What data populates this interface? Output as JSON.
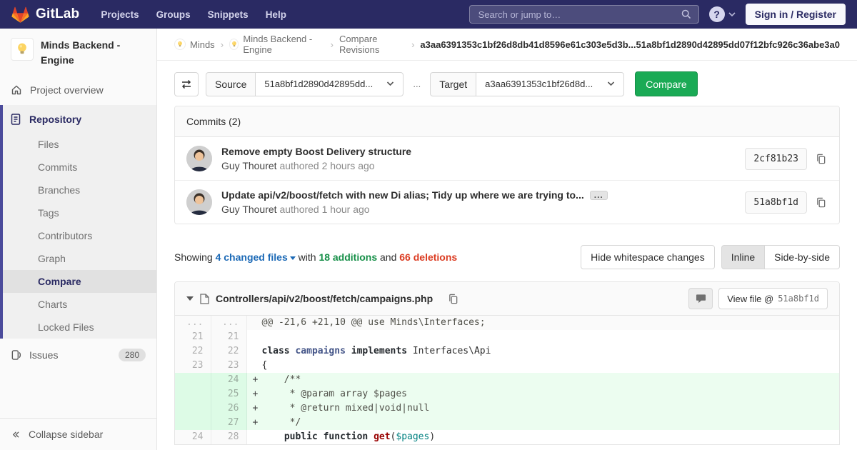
{
  "colors": {
    "navbar_bg": "#2a2a63",
    "accent_green": "#1aaa55",
    "link_blue": "#1b69b6",
    "additions_green": "#168f48",
    "deletions_red": "#db3b21",
    "sidebar_active_indigo": "#4b4b9b",
    "added_line_bg": "#ecfdf0",
    "added_gutter_bg": "#ddfbe6"
  },
  "navbar": {
    "logo_text": "GitLab",
    "items": [
      "Projects",
      "Groups",
      "Snippets",
      "Help"
    ],
    "search_placeholder": "Search or jump to…",
    "help_glyph": "?",
    "signin_label": "Sign in / Register"
  },
  "sidebar": {
    "project_name": "Minds Backend - Engine",
    "overview_label": "Project overview",
    "repository_label": "Repository",
    "repo_items": [
      "Files",
      "Commits",
      "Branches",
      "Tags",
      "Contributors",
      "Graph",
      "Compare",
      "Charts",
      "Locked Files"
    ],
    "active_item": "Compare",
    "issues_label": "Issues",
    "issues_count": "280",
    "collapse_label": "Collapse sidebar"
  },
  "breadcrumb": {
    "items": [
      {
        "label": "Minds",
        "avatar": true
      },
      {
        "label": "Minds Backend - Engine",
        "avatar": true
      },
      {
        "label": "Compare Revisions",
        "avatar": false
      }
    ],
    "current": "a3aa6391353c1bf26d8db41d8596e61c303e5d3b...51a8bf1d2890d42895dd07f12bfc926c36abe3a0"
  },
  "compare_form": {
    "source_label": "Source",
    "source_value": "51a8bf1d2890d42895dd...",
    "separator": "...",
    "target_label": "Target",
    "target_value": "a3aa6391353c1bf26d8d...",
    "compare_button": "Compare"
  },
  "commits": {
    "header": "Commits (2)",
    "items": [
      {
        "title": "Remove empty Boost Delivery structure",
        "author": "Guy Thouret",
        "meta": "authored 2 hours ago",
        "hash": "2cf81b23",
        "expandable": false
      },
      {
        "title": "Update api/v2/boost/fetch with new Di alias; Tidy up where we are trying to...",
        "author": "Guy Thouret",
        "meta": "authored 1 hour ago",
        "hash": "51a8bf1d",
        "expandable": true
      }
    ]
  },
  "diff_summary": {
    "showing": "Showing",
    "files_link": "4 changed files",
    "with_word": "with",
    "additions": "18 additions",
    "and_word": "and",
    "deletions": "66 deletions",
    "hide_whitespace": "Hide whitespace changes",
    "inline": "Inline",
    "side_by_side": "Side-by-side"
  },
  "file_diff": {
    "path": "Controllers/api/v2/boost/fetch/campaigns.php",
    "view_file_label": "View file @",
    "view_file_hash": "51a8bf1d",
    "lines": [
      {
        "type": "match",
        "old": "...",
        "new": "...",
        "sign": "",
        "segments": [
          {
            "t": "c",
            "s": "@@ -21,6 +21,10 @@ use Minds\\Interfaces;"
          }
        ]
      },
      {
        "type": "ctx",
        "old": "21",
        "new": "21",
        "sign": "",
        "segments": []
      },
      {
        "type": "ctx",
        "old": "22",
        "new": "22",
        "sign": "",
        "segments": [
          {
            "t": "k",
            "s": "class"
          },
          {
            "t": "p",
            "s": " "
          },
          {
            "t": "nc",
            "s": "campaigns"
          },
          {
            "t": "p",
            "s": " "
          },
          {
            "t": "k",
            "s": "implements"
          },
          {
            "t": "p",
            "s": " Interfaces\\Api"
          }
        ]
      },
      {
        "type": "ctx",
        "old": "23",
        "new": "23",
        "sign": "",
        "segments": [
          {
            "t": "p",
            "s": "{"
          }
        ]
      },
      {
        "type": "add",
        "old": "",
        "new": "24",
        "sign": "+",
        "segments": [
          {
            "t": "c",
            "s": "    /**"
          }
        ]
      },
      {
        "type": "add",
        "old": "",
        "new": "25",
        "sign": "+",
        "segments": [
          {
            "t": "c",
            "s": "     * @param array $pages"
          }
        ]
      },
      {
        "type": "add",
        "old": "",
        "new": "26",
        "sign": "+",
        "segments": [
          {
            "t": "c",
            "s": "     * @return mixed|void|null"
          }
        ]
      },
      {
        "type": "add",
        "old": "",
        "new": "27",
        "sign": "+",
        "segments": [
          {
            "t": "c",
            "s": "     */"
          }
        ]
      },
      {
        "type": "ctx",
        "old": "24",
        "new": "28",
        "sign": "",
        "segments": [
          {
            "t": "p",
            "s": "    "
          },
          {
            "t": "k",
            "s": "public"
          },
          {
            "t": "p",
            "s": " "
          },
          {
            "t": "k",
            "s": "function"
          },
          {
            "t": "p",
            "s": " "
          },
          {
            "t": "nf",
            "s": "get"
          },
          {
            "t": "p",
            "s": "("
          },
          {
            "t": "nv",
            "s": "$pages"
          },
          {
            "t": "p",
            "s": ")"
          }
        ]
      }
    ]
  }
}
